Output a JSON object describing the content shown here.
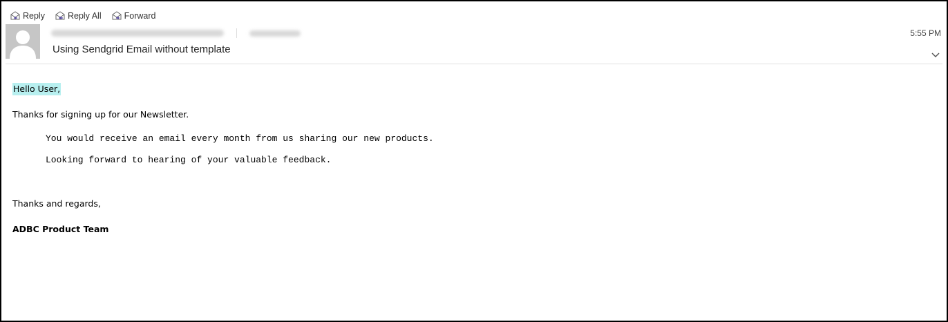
{
  "toolbar": {
    "reply_label": "Reply",
    "reply_all_label": "Reply All",
    "forward_label": "Forward"
  },
  "header": {
    "subject": "Using Sendgrid Email without template",
    "time": "5:55 PM"
  },
  "body": {
    "greeting": "Hello User,",
    "line1": "Thanks for signing up for our Newsletter.",
    "mono_line1": "You would receive an email every month from us sharing our new products.",
    "mono_line2": "Looking forward to hearing of your valuable feedback.",
    "closing": "Thanks and regards,",
    "signature": "ADBC Product Team"
  },
  "colors": {
    "greeting_highlight": "#b7efef",
    "icon_accent": "#5b4fa6"
  }
}
